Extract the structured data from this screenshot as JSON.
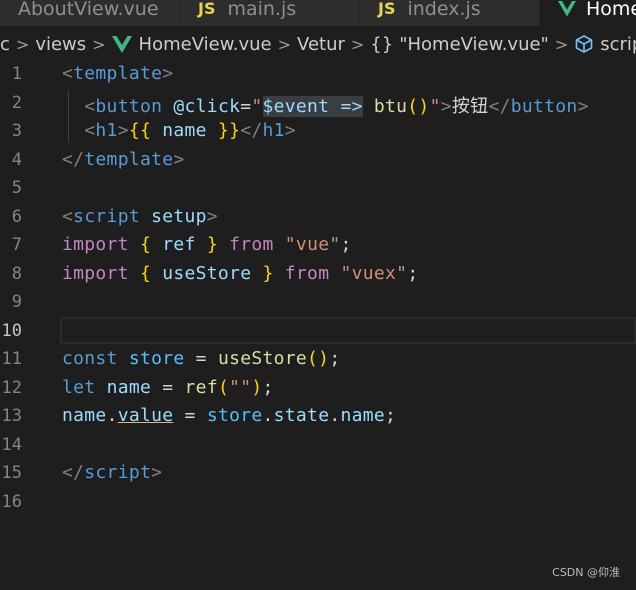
{
  "tabs": [
    {
      "label": "AboutView.vue",
      "icon": "vue-icon"
    },
    {
      "label": "main.js",
      "badge": "JS"
    },
    {
      "label": "index.js",
      "badge": "JS"
    },
    {
      "label": "Home",
      "icon": "vue-icon",
      "active": true
    }
  ],
  "breadcrumb": {
    "root": "c",
    "folder": "views",
    "file": "HomeView.vue",
    "language": "Vetur",
    "component_braces": "{}",
    "component": "\"HomeView.vue\"",
    "section": "script"
  },
  "editor": {
    "current_line": 10,
    "lines": [
      {
        "n": "1"
      },
      {
        "n": "2"
      },
      {
        "n": "3"
      },
      {
        "n": "4"
      },
      {
        "n": "5"
      },
      {
        "n": "6"
      },
      {
        "n": "7"
      },
      {
        "n": "8"
      },
      {
        "n": "9"
      },
      {
        "n": "10"
      },
      {
        "n": "11"
      },
      {
        "n": "12"
      },
      {
        "n": "13"
      },
      {
        "n": "14"
      },
      {
        "n": "15"
      },
      {
        "n": "16"
      }
    ],
    "tokens": {
      "template": "template",
      "button": "button",
      "click_attr": "@click",
      "event": "$event =>",
      "btu_fn": "btu",
      "button_text": "按钮",
      "h1": "h1",
      "name": "name",
      "script": "script",
      "setup": "setup",
      "import": "import",
      "ref": "ref",
      "from": "from",
      "vue_str": "\"vue\"",
      "useStore": "useStore",
      "vuex_str": "\"vuex\"",
      "const": "const",
      "store": "store",
      "let": "let",
      "empty_str": "\"\"",
      "value": "value",
      "state": "state"
    }
  },
  "watermark": "CSDN @仰淮",
  "colors": {
    "background": "#1e1e1e",
    "keyword": "#c586c0",
    "tag": "#569cd6",
    "string": "#ce9178",
    "bracket": "#ffd700"
  }
}
